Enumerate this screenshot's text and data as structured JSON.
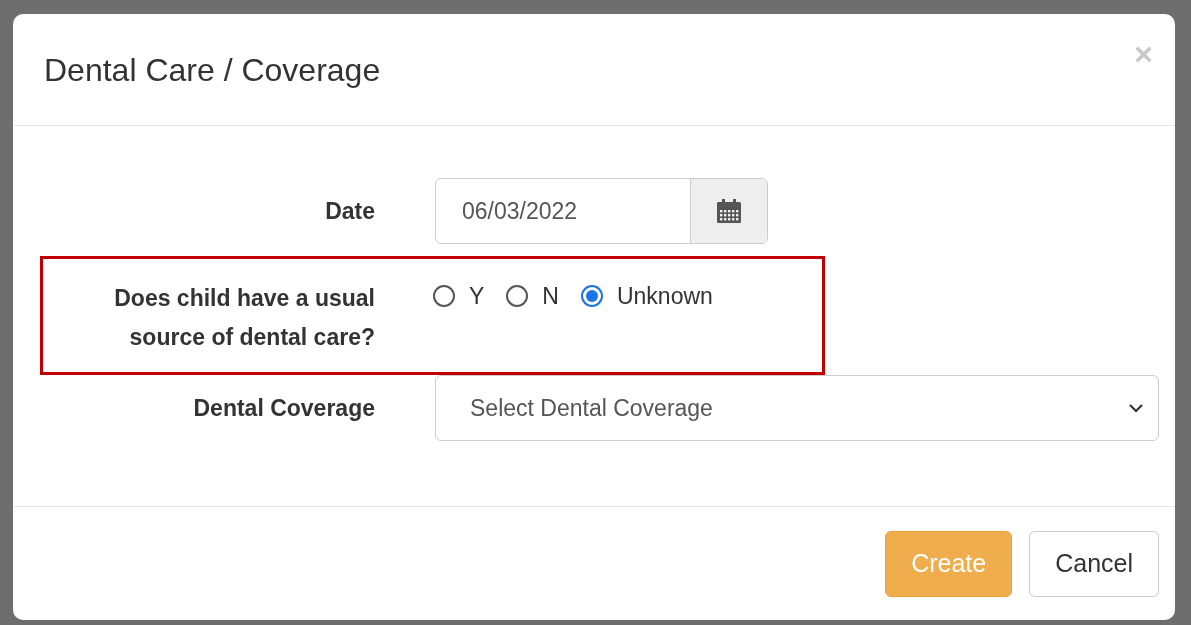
{
  "dialog": {
    "title": "Dental Care / Coverage",
    "close": "×"
  },
  "date": {
    "label": "Date",
    "value": "06/03/2022"
  },
  "usual_source": {
    "label": "Does child have a usual source of dental care?",
    "highlighted": true,
    "options": [
      {
        "label": "Y",
        "selected": false
      },
      {
        "label": "N",
        "selected": false
      },
      {
        "label": "Unknown",
        "selected": true
      }
    ]
  },
  "dental_coverage": {
    "label": "Dental Coverage",
    "placeholder": "Select Dental Coverage"
  },
  "buttons": [
    {
      "label": "Create",
      "kind": "primary"
    },
    {
      "label": "Cancel",
      "kind": "default"
    }
  ]
}
